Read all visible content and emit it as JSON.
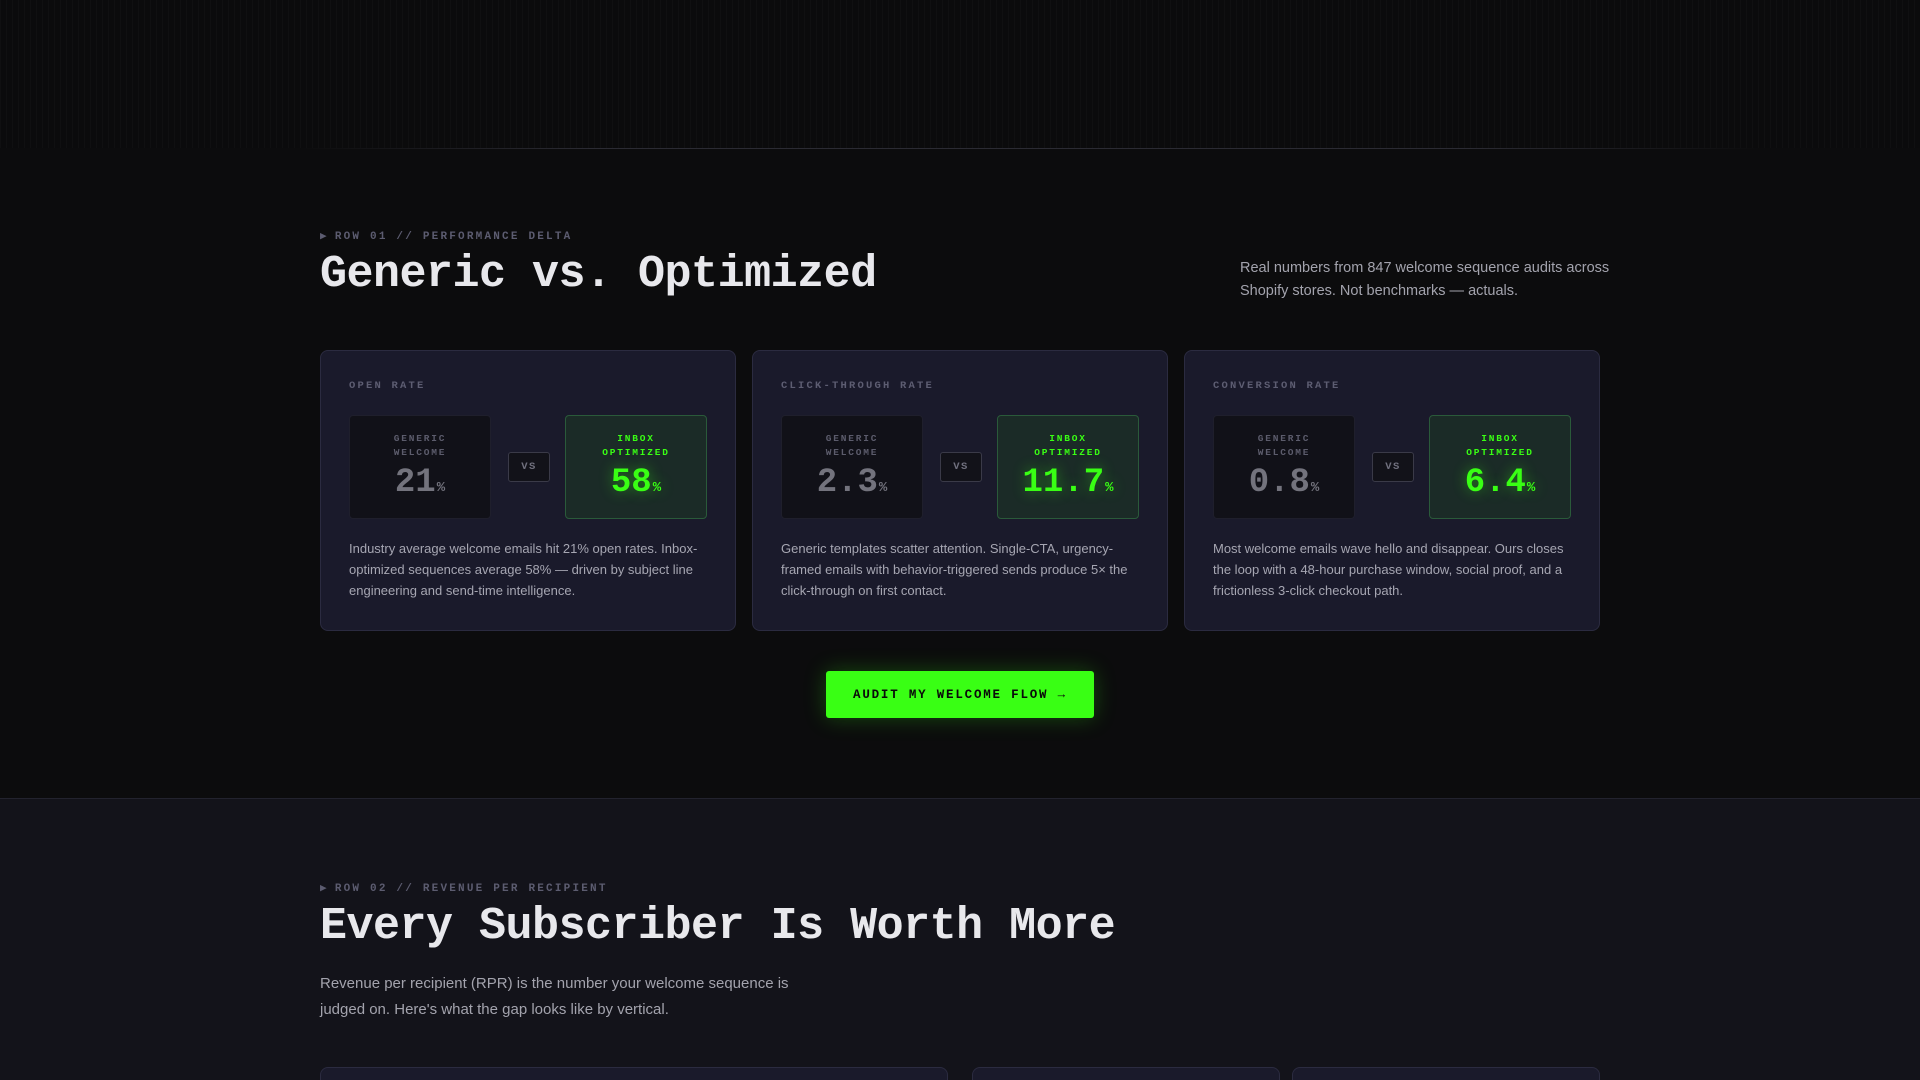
{
  "row01": {
    "eyebrow": "ROW 01 // PERFORMANCE DELTA",
    "eyebrow_marker": "▶",
    "title": "Generic vs. Optimized",
    "side_text": "Real numbers from 847 welcome sequence audits across Shopify stores. Not benchmarks — actuals.",
    "cards": [
      {
        "label": "OPEN RATE",
        "generic_label": "GENERIC WELCOME",
        "generic_value": "21",
        "optimized_label": "INBOX OPTIMIZED",
        "optimized_value": "58",
        "unit": "%",
        "vs": "VS",
        "description": "Industry average welcome emails hit 21% open rates. Inbox-optimized sequences average 58% — driven by subject line engineering and send-time intelligence."
      },
      {
        "label": "CLICK-THROUGH RATE",
        "generic_label": "GENERIC WELCOME",
        "generic_value": "2.3",
        "optimized_label": "INBOX OPTIMIZED",
        "optimized_value": "11.7",
        "unit": "%",
        "vs": "VS",
        "description": "Generic templates scatter attention. Single-CTA, urgency-framed emails with behavior-triggered sends produce 5× the click-through on first contact."
      },
      {
        "label": "CONVERSION RATE",
        "generic_label": "GENERIC WELCOME",
        "generic_value": "0.8",
        "optimized_label": "INBOX OPTIMIZED",
        "optimized_value": "6.4",
        "unit": "%",
        "vs": "VS",
        "description": "Most welcome emails wave hello and disappear. Ours closes the loop with a 48-hour purchase window, social proof, and a frictionless 3-click checkout path."
      }
    ],
    "cta_label": "AUDIT MY WELCOME FLOW →"
  },
  "row02": {
    "eyebrow": "ROW 02 // REVENUE PER RECIPIENT",
    "eyebrow_marker": "▶",
    "title": "Every Subscriber Is Worth More",
    "text": "Revenue per recipient (RPR) is the number your welcome sequence is judged on. Here's what the gap looks like by vertical."
  },
  "colors": {
    "accent": "#39ff14",
    "background": "#0c0c0d",
    "card": "#1a1a2b"
  }
}
